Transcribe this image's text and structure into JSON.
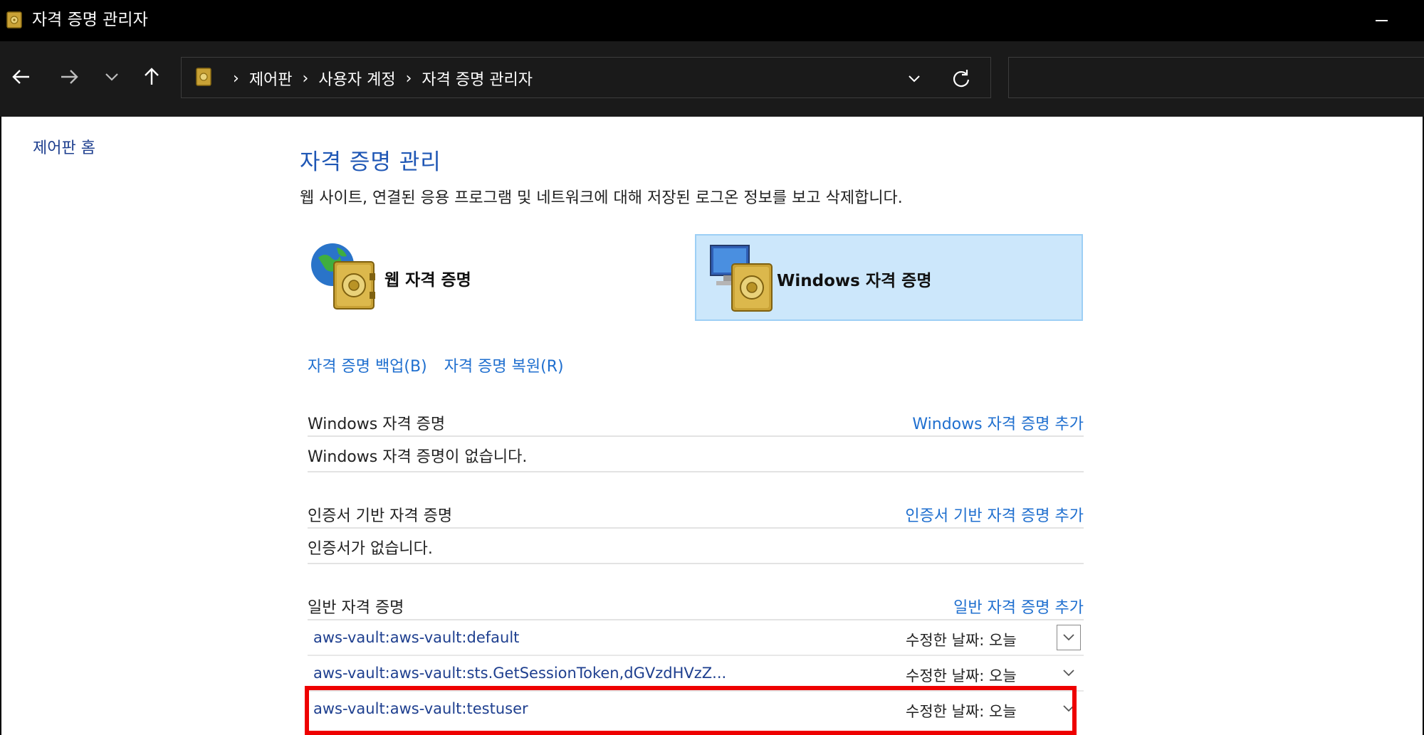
{
  "window": {
    "title": "자격 증명 관리자"
  },
  "address_bar": {
    "breadcrumbs": [
      "제어판",
      "사용자 계정",
      "자격 증명 관리자"
    ],
    "separator": "›"
  },
  "sidebar": {
    "home_link": "제어판 홈"
  },
  "main": {
    "heading": "자격 증명 관리",
    "description": "웹 사이트, 연결된 응용 프로그램 및 네트워크에 대해 저장된 로그온 정보를 보고 삭제합니다.",
    "categories": {
      "web": {
        "label": "웹 자격 증명",
        "selected": false
      },
      "windows": {
        "label": "Windows 자격 증명",
        "selected": true
      }
    },
    "links": {
      "backup": "자격 증명 백업(B)",
      "restore": "자격 증명 복원(R)"
    },
    "sections": {
      "windows": {
        "title": "Windows 자격 증명",
        "add": "Windows 자격 증명 추가",
        "empty": "Windows 자격 증명이 없습니다."
      },
      "certificate": {
        "title": "인증서 기반 자격 증명",
        "add": "인증서 기반 자격 증명 추가",
        "empty": "인증서가 없습니다."
      },
      "generic": {
        "title": "일반 자격 증명",
        "add": "일반 자격 증명 추가",
        "items": [
          {
            "name": "aws-vault:aws-vault:default",
            "modified": "수정한 날짜:  오늘"
          },
          {
            "name": "aws-vault:aws-vault:sts.GetSessionToken,dGVzdHVzZ...",
            "modified": "수정한 날짜:  오늘"
          },
          {
            "name": "aws-vault:aws-vault:testuser",
            "modified": "수정한 날짜:  오늘"
          }
        ]
      }
    }
  },
  "colors": {
    "titlebar": "#000000",
    "navbar": "#1a1a1a",
    "link_blue": "#1f6fcf",
    "heading_blue": "#1f57b5",
    "selected_bg": "#cce7fb",
    "highlight_red": "#ee0000"
  }
}
